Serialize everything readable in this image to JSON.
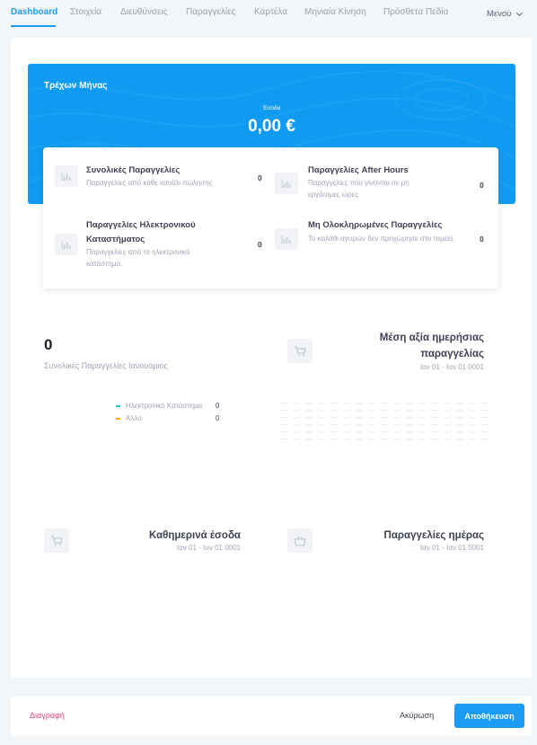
{
  "tabs": [
    {
      "label": "Dashboard",
      "active": true
    },
    {
      "label": "Στοιχεία"
    },
    {
      "label": "Διευθύνσεις"
    },
    {
      "label": "Παραγγελίες"
    },
    {
      "label": "Καρτέλα"
    },
    {
      "label": "Μηνιαία Κίνηση"
    },
    {
      "label": "Πρόσθετα Πεδία"
    }
  ],
  "menu": {
    "label": "Μενού",
    "icon": "chevron-down-icon"
  },
  "current_month": {
    "title": "Τρέχων Μήνας",
    "revenue_label": "Έσοδα",
    "revenue_value": "0,00 €",
    "accent_color": "#0f9bf2"
  },
  "stats": [
    {
      "title": "Συνολικές Παραγγελίες",
      "description": "Παραγγελίες από κάθε κανάλι πώλησης",
      "value": "0",
      "icon": "chart-icon"
    },
    {
      "title": "Παραγγελίες After Hours",
      "description": "Παραγγελίες που γίνονται σε μη εργάσιμες ώρες",
      "value": "0",
      "icon": "chart-icon"
    },
    {
      "title": "Παραγγελίες Ηλεκτρονικού Καταστήματος",
      "description": "Παραγγελίες από το ηλεκτρονικό κατάστημα.",
      "value": "0",
      "icon": "chart-icon"
    },
    {
      "title": "Μη Ολοκληρωμένες Παραγγελίες",
      "description": "Το καλάθι αγορών δεν προχώρησε στο ταμείο.",
      "value": "0",
      "icon": "chart-icon"
    }
  ],
  "total_orders": {
    "value": "0",
    "label": "Συνολικές Παραγγελίες Ιανουάριος"
  },
  "legend": [
    {
      "label": "Ηλεκτρονικό Κατάστημα",
      "value": "0",
      "color": "#1bc5bd"
    },
    {
      "label": "Άλλο",
      "value": "0",
      "color": "#ffa800"
    }
  ],
  "avg_daily": {
    "title_line1": "Μέση αξία ημερήσιας",
    "title_line2": "παραγγελίας",
    "range": "Ιαν 01 - Ιαν 01 0001",
    "icon": "cart-icon"
  },
  "daily_revenue": {
    "title": "Καθημερινά έσοδα",
    "range": "Ιαν 01 - Ιαν 01 0001",
    "icon": "cart-icon"
  },
  "daily_orders": {
    "title": "Παραγγελίες ημέρας",
    "range": "Ιαν 01 - Ιαν 01 0001",
    "icon": "basket-icon"
  },
  "footer": {
    "delete_label": "Διαγραφή",
    "cancel_label": "Ακύρωση",
    "save_label": "Αποθήκευση"
  }
}
